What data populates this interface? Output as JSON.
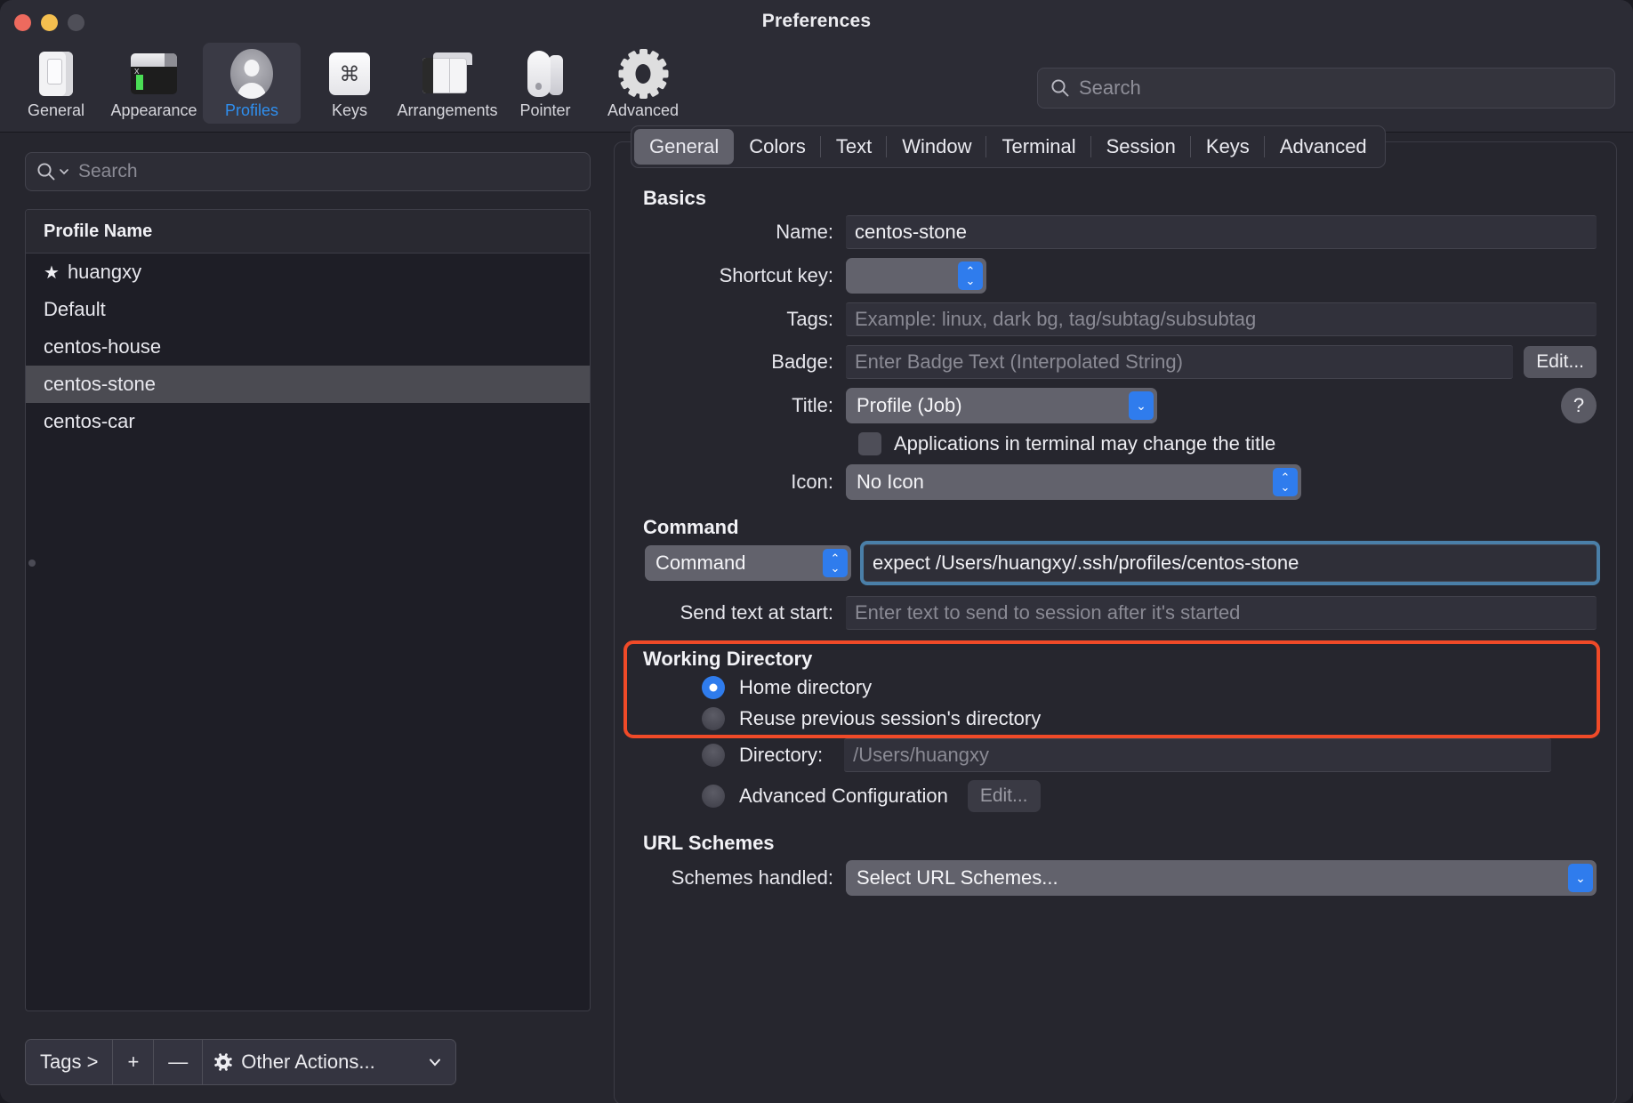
{
  "window": {
    "title": "Preferences",
    "traffic": {
      "close": "close-button",
      "minimize": "minimize-button",
      "zoom": "zoom-button"
    }
  },
  "toolbar": {
    "items": [
      {
        "label": "General",
        "icon": "general-icon",
        "active": false
      },
      {
        "label": "Appearance",
        "icon": "appearance-icon",
        "active": false
      },
      {
        "label": "Profiles",
        "icon": "profiles-icon",
        "active": true
      },
      {
        "label": "Keys",
        "icon": "keys-icon",
        "active": false
      },
      {
        "label": "Arrangements",
        "icon": "arrangements-icon",
        "active": false
      },
      {
        "label": "Pointer",
        "icon": "pointer-icon",
        "active": false
      },
      {
        "label": "Advanced",
        "icon": "advanced-gear-icon",
        "active": false
      }
    ],
    "search_placeholder": "Search"
  },
  "sidebar": {
    "search_placeholder": "Search",
    "table_header": "Profile Name",
    "profiles": [
      {
        "name": "huangxy",
        "starred": true,
        "selected": false
      },
      {
        "name": "Default",
        "starred": false,
        "selected": false
      },
      {
        "name": "centos-house",
        "starred": false,
        "selected": false
      },
      {
        "name": "centos-stone",
        "starred": false,
        "selected": true
      },
      {
        "name": "centos-car",
        "starred": false,
        "selected": false
      }
    ],
    "star_glyph": "★",
    "bottom_bar": {
      "tags_label": "Tags >",
      "add_label": "+",
      "remove_label": "—",
      "other_actions_label": "Other Actions...",
      "gear_glyph": "✿",
      "chevron_glyph": "⌄"
    }
  },
  "tabs": [
    {
      "label": "General",
      "active": true
    },
    {
      "label": "Colors",
      "active": false
    },
    {
      "label": "Text",
      "active": false
    },
    {
      "label": "Window",
      "active": false
    },
    {
      "label": "Terminal",
      "active": false
    },
    {
      "label": "Session",
      "active": false
    },
    {
      "label": "Keys",
      "active": false
    },
    {
      "label": "Advanced",
      "active": false
    }
  ],
  "general": {
    "basics_title": "Basics",
    "name_label": "Name:",
    "name_value": "centos-stone",
    "shortcut_label": "Shortcut key:",
    "shortcut_value": "",
    "tags_label": "Tags:",
    "tags_placeholder": "Example: linux, dark bg, tag/subtag/subsubtag",
    "badge_label": "Badge:",
    "badge_placeholder": "Enter Badge Text (Interpolated String)",
    "badge_edit_label": "Edit...",
    "title_label": "Title:",
    "title_value": "Profile (Job)",
    "help_glyph": "?",
    "apps_change_title_label": "Applications in terminal may change the title",
    "apps_change_title_checked": false,
    "icon_label": "Icon:",
    "icon_value": "No Icon",
    "command_title": "Command",
    "command_mode_value": "Command",
    "command_value": "expect /Users/huangxy/.ssh/profiles/centos-stone",
    "send_text_label": "Send text at start:",
    "send_text_placeholder": "Enter text to send to session after it's started",
    "working_directory_title": "Working Directory",
    "wd_options": [
      {
        "label": "Home directory",
        "selected": true
      },
      {
        "label": "Reuse previous session's directory",
        "selected": false
      },
      {
        "label": "Directory:",
        "selected": false
      },
      {
        "label": "Advanced Configuration",
        "selected": false
      }
    ],
    "directory_placeholder": "/Users/huangxy",
    "advanced_edit_label": "Edit...",
    "url_schemes_title": "URL Schemes",
    "schemes_label": "Schemes handled:",
    "schemes_value": "Select URL Schemes..."
  },
  "colors": {
    "accent_blue": "#2f7ced",
    "highlight_red": "#f04a28",
    "focus_blue": "#4a7fa8",
    "window_bg": "#26262e",
    "toolbar_bg": "#2c2c35"
  }
}
